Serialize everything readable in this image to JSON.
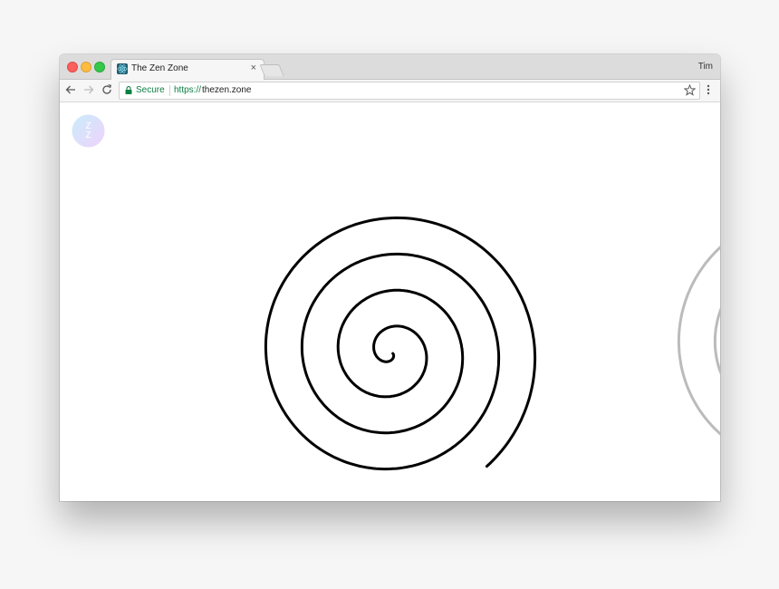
{
  "window": {
    "profile_name": "Tim"
  },
  "tab": {
    "title": "The Zen Zone",
    "close_glyph": "×",
    "favicon_icon": "atom-icon"
  },
  "toolbar": {
    "secure_label": "Secure",
    "url_scheme": "https://",
    "url_host": "thezen.zone"
  },
  "page": {
    "logo_glyph": "Z",
    "logo_icon": "zen-zone-logo-icon",
    "spiral_color": "#000000",
    "ghost_spiral_color": "#bbbbbb"
  },
  "colors": {
    "secure_green": "#0b8043",
    "close_red": "#fc605c",
    "minimize_yellow": "#fdbc40",
    "zoom_green": "#34c84a"
  }
}
